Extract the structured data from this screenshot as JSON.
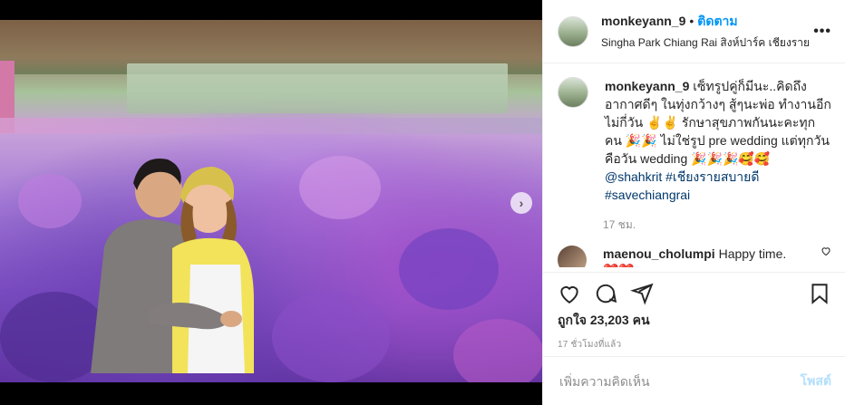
{
  "post": {
    "username": "monkeyann_9",
    "separator": "•",
    "follow_label": "ติดตาม",
    "location": "Singha Park Chiang Rai สิงห์ปาร์ค เชียงราย",
    "more_icon": "more-horizontal-icon"
  },
  "caption": {
    "username": "monkeyann_9",
    "text": "เซ็ทรูปคู่ก็มีนะ..คิดถึงอากาศดีๆ ในทุ่งกว้างๆ สู้ๆนะพ่อ ทำงานอีกไม่กี่วัน ✌️✌️ รักษาสุขภาพกันนะคะทุกคน 🎉🎉 ไม่ใช่รูป pre wedding แต่ทุกวันคือวัน wedding 🎉🎉🎉🥰🥰",
    "mention": "@shahkrit",
    "hashtag1": "#เชียงรายสบายดี",
    "hashtag2": "#savechiangrai",
    "time": "17 ชม."
  },
  "comment": {
    "username": "maenou_cholumpi",
    "text": "Happy time.",
    "emoji": "❤️❤️"
  },
  "actions": {
    "likes": "ถูกใจ 23,203 คน",
    "time_ago": "17 ชั่วโมงที่แล้ว"
  },
  "add_comment": {
    "placeholder": "เพิ่มความคิดเห็น",
    "post_label": "โพสต์"
  },
  "photo": {
    "next_arrow": "›"
  },
  "colors": {
    "accent": "#0095f6",
    "link": "#00376b",
    "muted": "#8e8e8e",
    "post_disabled": "#b2dffc"
  }
}
